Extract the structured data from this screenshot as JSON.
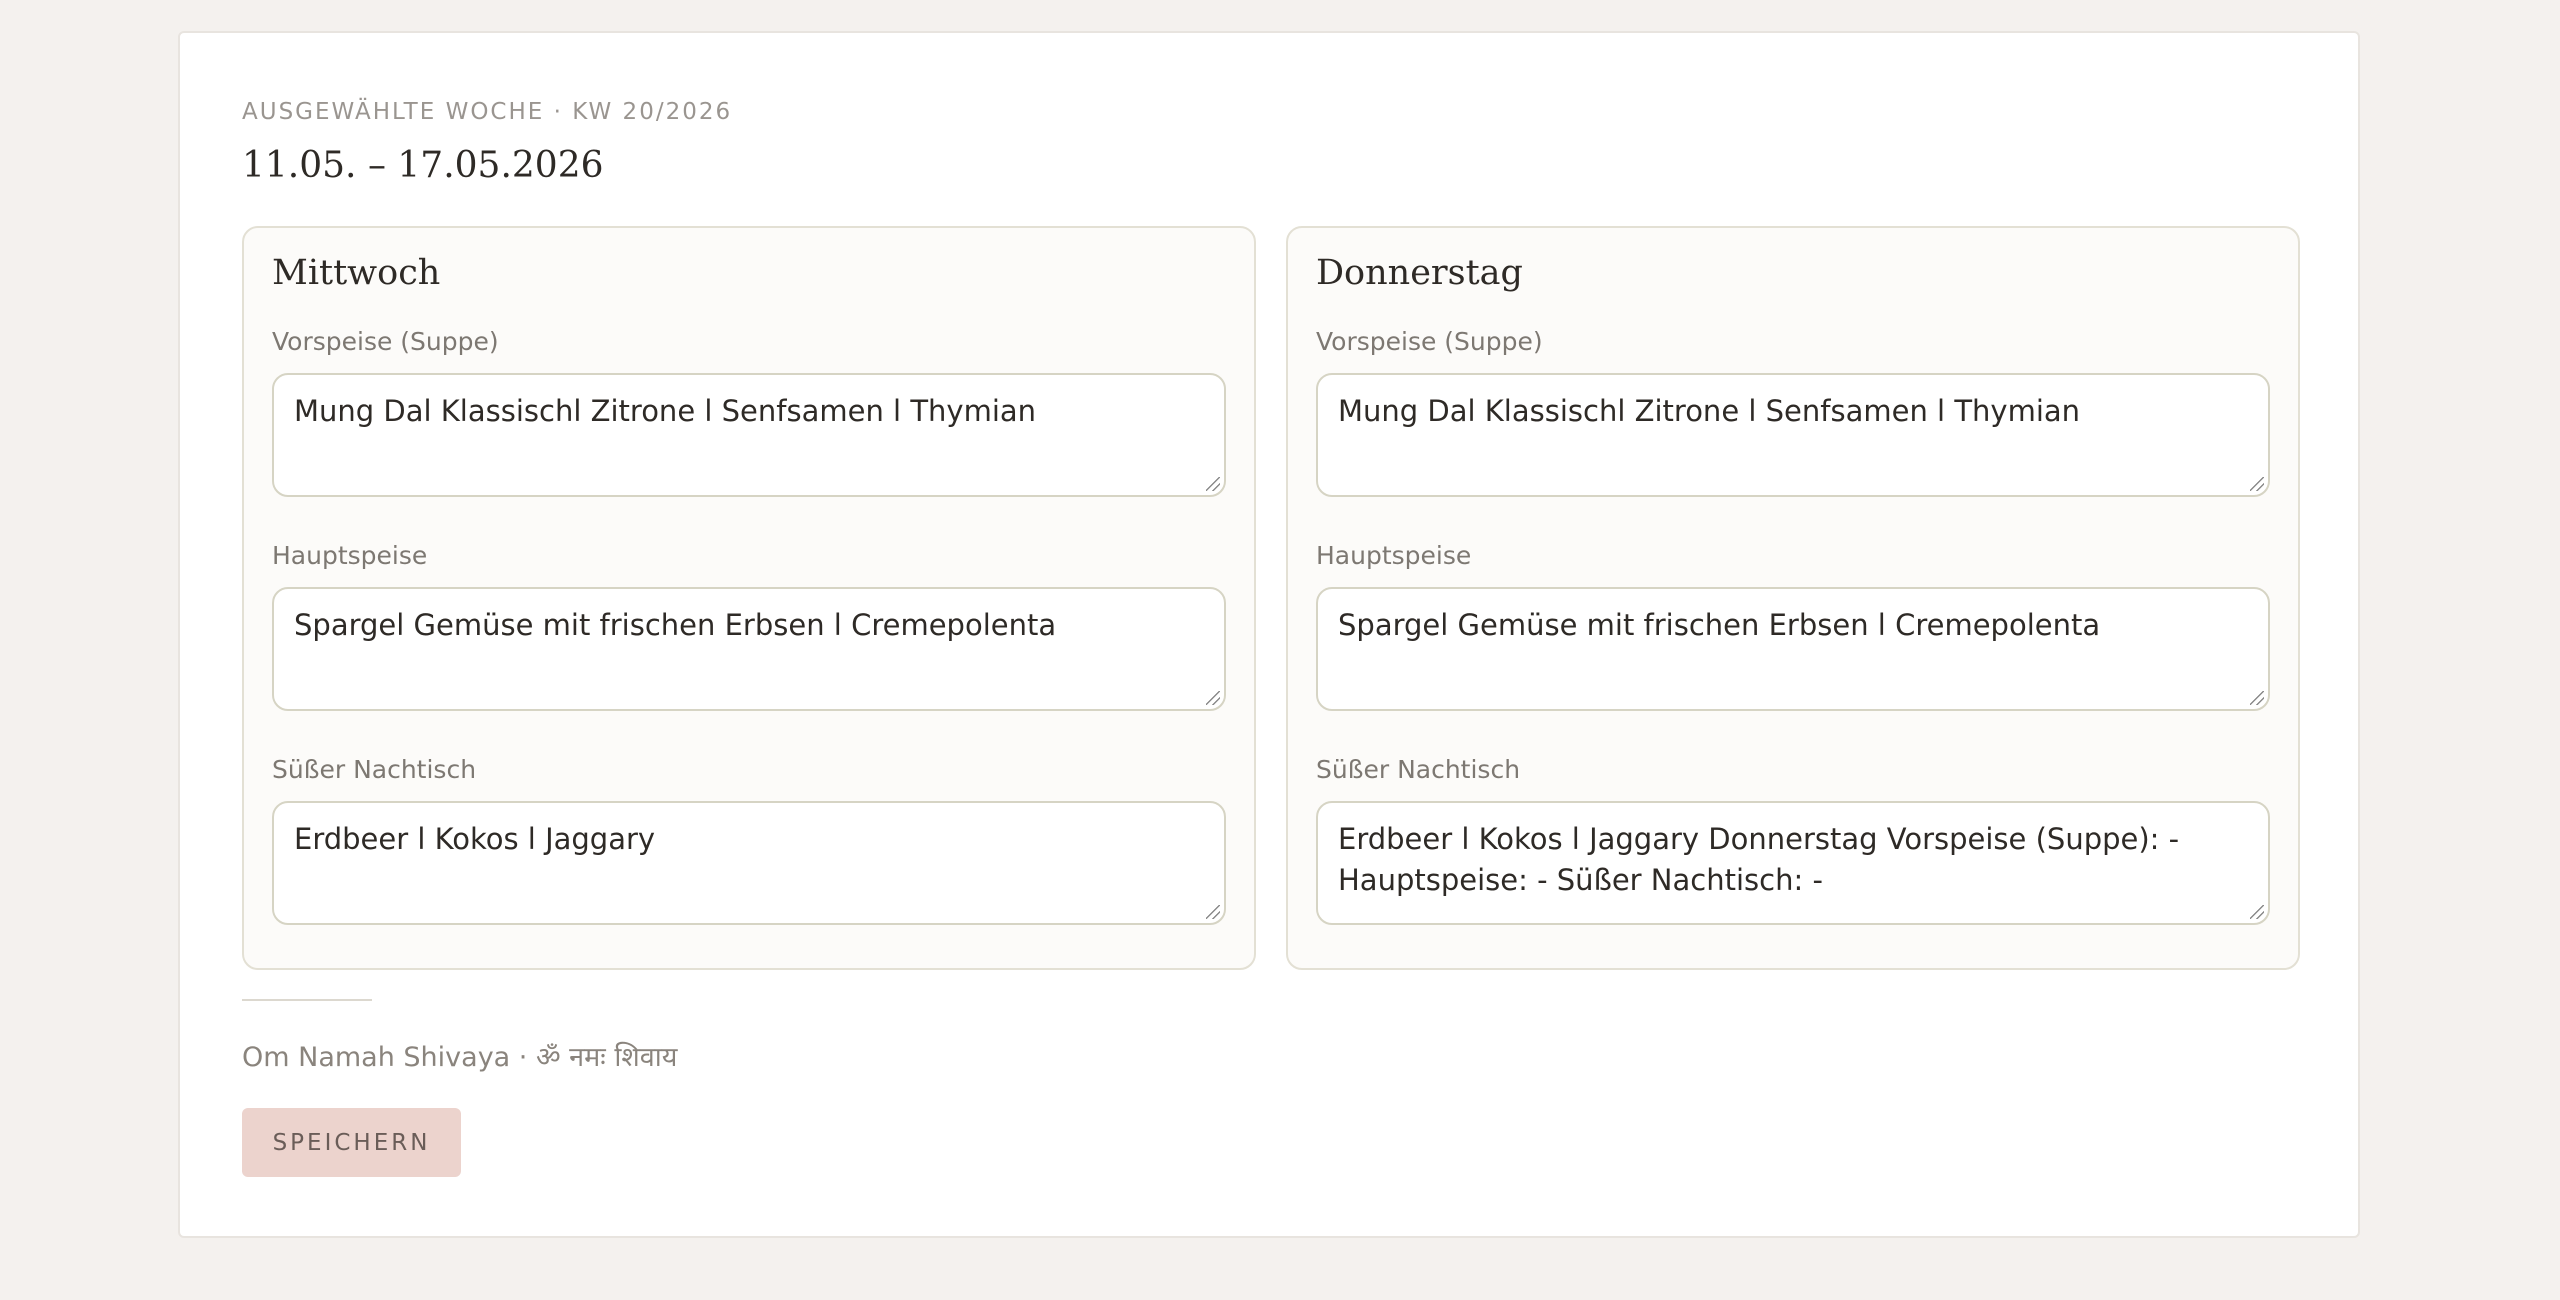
{
  "header": {
    "eyebrow": "AUSGEWÄHLTE WOCHE · KW 20/2026",
    "date_range": "11.05. – 17.05.2026"
  },
  "days": [
    {
      "name": "Mittwoch",
      "fields": [
        {
          "label": "Vorspeise (Suppe)",
          "value": "Mung Dal Klassischl Zitrone l Senfsamen l Thymian"
        },
        {
          "label": "Hauptspeise",
          "value": "Spargel Gemüse mit frischen Erbsen l Cremepolenta"
        },
        {
          "label": "Süßer Nachtisch",
          "value": "Erdbeer l Kokos l Jaggary"
        }
      ]
    },
    {
      "name": "Donnerstag",
      "fields": [
        {
          "label": "Vorspeise (Suppe)",
          "value": "Mung Dal Klassischl Zitrone l Senfsamen l Thymian"
        },
        {
          "label": "Hauptspeise",
          "value": "Spargel Gemüse mit frischen Erbsen l Cremepolenta"
        },
        {
          "label": "Süßer Nachtisch",
          "value": "Erdbeer l Kokos l Jaggary Donnerstag Vorspeise (Suppe): - Hauptspeise: - Süßer Nachtisch: -"
        }
      ]
    }
  ],
  "footer": {
    "mantra": "Om Namah Shivaya · ॐ नमः शिवाय",
    "save_label": "SPEICHERN"
  }
}
